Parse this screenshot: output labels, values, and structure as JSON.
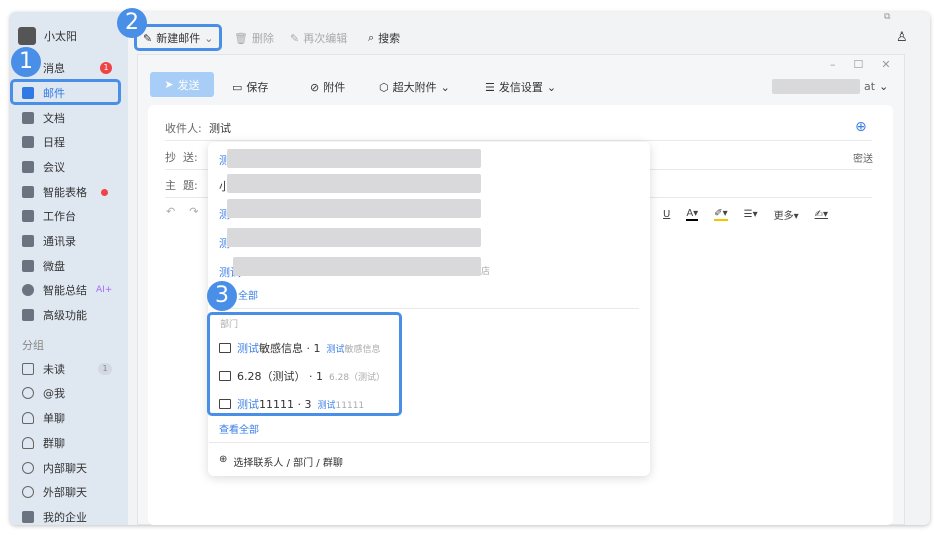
{
  "sidebar": {
    "user": "小太阳",
    "items": [
      {
        "label": "消息",
        "badge": "1"
      },
      {
        "label": "邮件"
      },
      {
        "label": "文档"
      },
      {
        "label": "日程"
      },
      {
        "label": "会议"
      },
      {
        "label": "智能表格"
      },
      {
        "label": "工作台"
      },
      {
        "label": "通讯录"
      },
      {
        "label": "微盘"
      },
      {
        "label": "智能总结",
        "tag": "AI+"
      },
      {
        "label": "高级功能"
      }
    ],
    "group_label": "分组",
    "groups": [
      {
        "label": "未读",
        "count": "1"
      },
      {
        "label": "@我"
      },
      {
        "label": "单聊"
      },
      {
        "label": "群聊"
      },
      {
        "label": "内部聊天"
      },
      {
        "label": "外部聊天"
      },
      {
        "label": "我的企业"
      }
    ]
  },
  "toolbar": {
    "new_mail": "新建邮件",
    "delete": "删除",
    "reedit": "再次编辑",
    "search": "搜索"
  },
  "compose": {
    "send": "发送",
    "save": "保存",
    "attach": "附件",
    "large_attach": "超大附件",
    "send_settings": "发信设置",
    "account_suffix": "at",
    "to_label": "收件人:",
    "to_value": "测试",
    "cc_label": "抄  送:",
    "bcc": "密送",
    "subject_label": "主  题:",
    "more": "更多"
  },
  "dropdown": {
    "contacts": [
      {
        "prefix": "测"
      },
      {
        "prefix": "小"
      },
      {
        "prefix": "测"
      },
      {
        "prefix": "测"
      },
      {
        "prefix": "测试",
        "suffix": "店"
      }
    ],
    "view_all_1": "全部",
    "dept_header": "部门",
    "departments": [
      {
        "name_hl": "测试",
        "name": "敏感信息",
        "count": "· 1",
        "path_hl": "测试",
        "path": "敏感信息"
      },
      {
        "name_hl": "",
        "name": "6.28（测试）",
        "count": "· 1",
        "path_hl": "",
        "path": "6.28（测试）"
      },
      {
        "name_hl": "测试",
        "name": "11111",
        "count": "· 3",
        "path_hl": "测试",
        "path": "11111"
      }
    ],
    "view_all_2": "查看全部",
    "select": "选择联系人 / 部门 / 群聊"
  },
  "annotations": [
    "1",
    "2",
    "3"
  ],
  "colors": {
    "accent": "#3a7ee6",
    "annotation": "#4a8fe7",
    "sidebar": "#dfe7f1"
  }
}
